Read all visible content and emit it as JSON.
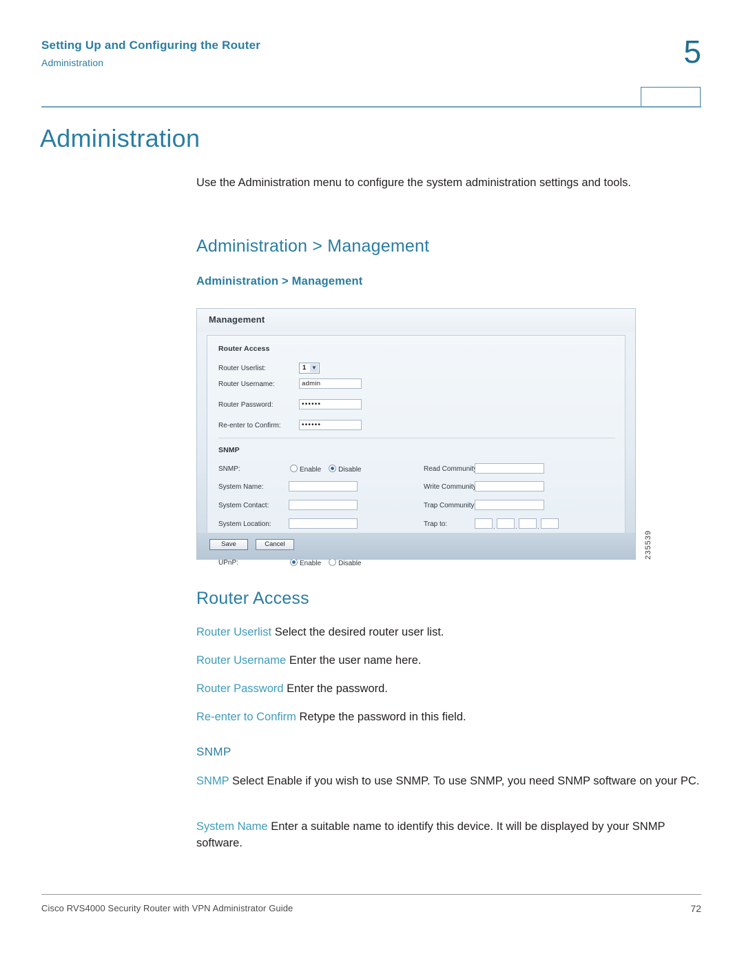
{
  "header": {
    "running_title": "Setting Up and Configuring the Router",
    "running_subtitle": "Administration",
    "chapter_number": "5"
  },
  "chapter_title": "Administration",
  "intro_paragraph": "Use the Administration menu to configure the system administration settings and tools.",
  "section_heading": "Administration > Management",
  "figure_caption": "Administration > Management",
  "figure": {
    "id_label": "235539",
    "window_title": "Management",
    "groups": {
      "router_access": {
        "title": "Router Access",
        "fields": [
          {
            "label": "Router Userlist:",
            "type": "select",
            "value": "1"
          },
          {
            "label": "Router Username:",
            "type": "text",
            "value": "admin"
          },
          {
            "label": "Router Password:",
            "type": "password",
            "value": "••••••"
          },
          {
            "label": "Re-enter to Confirm:",
            "type": "password",
            "value": "••••••"
          }
        ]
      },
      "snmp": {
        "title": "SNMP",
        "toggle_label": "SNMP:",
        "enable_label": "Enable",
        "disable_label": "Disable",
        "selected": "Disable",
        "left_fields": [
          {
            "label": "System Name:",
            "value": ""
          },
          {
            "label": "System Contact:",
            "value": ""
          },
          {
            "label": "System Location:",
            "value": ""
          }
        ],
        "right_fields": [
          {
            "label": "Read Community:",
            "value": ""
          },
          {
            "label": "Write Community:",
            "value": ""
          },
          {
            "label": "Trap Community:",
            "value": ""
          }
        ],
        "trap_to_label": "Trap to:",
        "trap_to_octets": [
          "",
          "",
          "",
          ""
        ]
      },
      "upnp": {
        "title": "UPnP",
        "toggle_label": "UPnP:",
        "enable_label": "Enable",
        "disable_label": "Disable",
        "selected": "Enable"
      }
    },
    "buttons": {
      "save": "Save",
      "cancel": "Cancel"
    }
  },
  "router_access_section": {
    "heading": "Router Access",
    "definitions": [
      {
        "term": "Router Userlist",
        "text": " Select the desired router user list."
      },
      {
        "term": "Router Username",
        "text": " Enter the user name here."
      },
      {
        "term": "Router Password",
        "text": " Enter the password."
      },
      {
        "term": "Re-enter to Confirm",
        "text": " Retype the password in this field."
      }
    ]
  },
  "snmp_section": {
    "heading": "SNMP",
    "definitions": [
      {
        "term": "SNMP",
        "text": " Select Enable if you wish to use SNMP. To use SNMP, you need SNMP software on your PC."
      },
      {
        "term": "System Name",
        "text": " Enter a suitable name to identify this device. It will be displayed by your SNMP software."
      }
    ]
  },
  "footer": {
    "left": "Cisco RVS4000 Security Router with VPN Administrator Guide",
    "page_number": "72"
  },
  "colors": {
    "accent_teal": "#2a7da3",
    "term_teal": "#3f9bbd",
    "rule_blue": "#6ea3c6"
  }
}
